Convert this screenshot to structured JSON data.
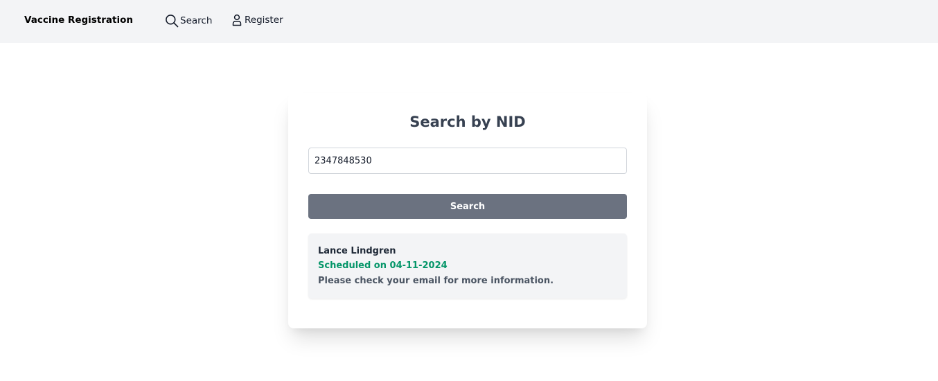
{
  "navbar": {
    "brand": "Vaccine Registration",
    "links": [
      {
        "label": "Search",
        "icon": "search-icon"
      },
      {
        "label": "Register",
        "icon": "user-icon"
      }
    ]
  },
  "search_card": {
    "title": "Search by NID",
    "nid_input": {
      "value": "2347848530",
      "placeholder": ""
    },
    "button_label": "Search"
  },
  "result": {
    "name": "Lance Lindgren",
    "status": "Scheduled on 04-11-2024",
    "note": "Please check your email for more information."
  },
  "colors": {
    "navbar_bg": "#f3f4f6",
    "button_bg": "#6b7280",
    "status_green": "#059669",
    "title_text": "#374151"
  }
}
